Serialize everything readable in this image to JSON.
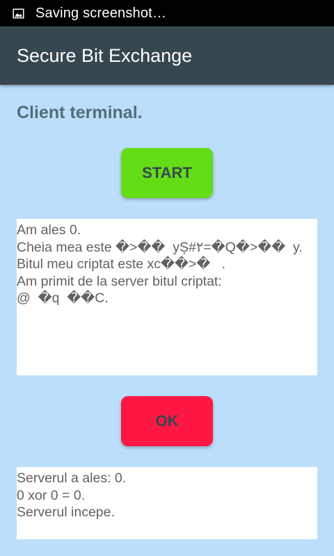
{
  "status_bar": {
    "notification_icon": "image-icon",
    "text": "Saving screenshot…"
  },
  "app_bar": {
    "title": "Secure Bit Exchange",
    "color": "#37474f"
  },
  "main": {
    "heading": "Client terminal.",
    "start_button": {
      "label": "START",
      "color": "#64dd17"
    },
    "client_log": [
      "Am ales 0.",
      "Cheia mea este �>��  yȘ#٢=�Q�>��  y.",
      "Bitul meu criptat este xc��>�   .",
      "Am primit de la server bitul criptat:",
      "@  �q  ��C."
    ],
    "ok_button": {
      "label": "OK",
      "color": "#ff1744"
    },
    "server_log": [
      "Serverul a ales: 0.",
      "0 xor 0 = 0.",
      "Serverul incepe."
    ]
  },
  "colors": {
    "background": "#bbdefb",
    "heading_text": "#546e7a",
    "log_text": "#616161"
  }
}
